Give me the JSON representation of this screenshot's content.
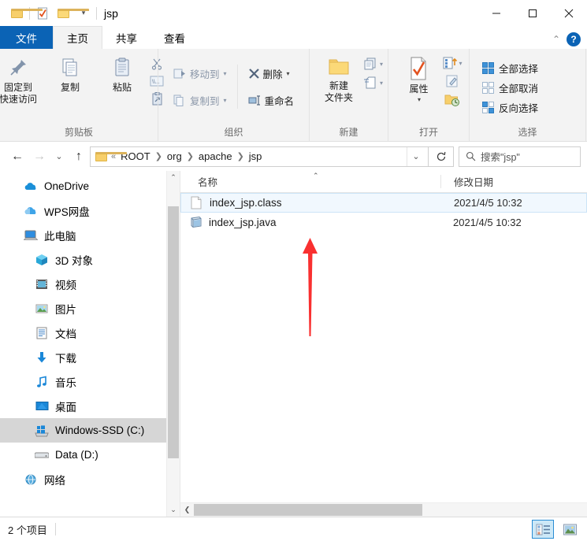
{
  "window": {
    "title": "jsp",
    "quick_access": [
      "folder-icon",
      "properties-icon",
      "new-folder-icon",
      "customize-dropdown"
    ],
    "controls": {
      "minimize": "—",
      "maximize": "☐",
      "close": "✕"
    }
  },
  "ribbon": {
    "tabs": [
      {
        "label": "文件",
        "kind": "file"
      },
      {
        "label": "主页",
        "kind": "active"
      },
      {
        "label": "共享",
        "kind": "normal"
      },
      {
        "label": "查看",
        "kind": "normal"
      }
    ],
    "collapse_icon": "chevron-up-icon",
    "help_label": "?",
    "groups": [
      {
        "name": "剪贴板",
        "big": [
          {
            "label1": "固定到",
            "label2": "快速访问",
            "icon": "pin-icon"
          },
          {
            "label1": "复制",
            "label2": "",
            "icon": "copy-icon"
          },
          {
            "label1": "粘贴",
            "label2": "",
            "icon": "paste-icon"
          }
        ],
        "small": [
          "剪切",
          "复制路径",
          "粘贴快捷方式"
        ]
      },
      {
        "name": "组织",
        "items": [
          {
            "label": "移动到",
            "icon": "move-to-icon",
            "caret": true,
            "enabled": false
          },
          {
            "label": "复制到",
            "icon": "copy-to-icon",
            "caret": true,
            "enabled": false
          },
          {
            "label": "删除",
            "icon": "delete-icon",
            "caret": true,
            "enabled": true
          },
          {
            "label": "重命名",
            "icon": "rename-icon",
            "caret": false,
            "enabled": true
          }
        ]
      },
      {
        "name": "新建",
        "big": [
          {
            "label1": "新建",
            "label2": "文件夹",
            "icon": "new-folder-icon"
          }
        ],
        "small": [
          "新建项目",
          "轻松访问"
        ]
      },
      {
        "name": "打开",
        "big": [
          {
            "label1": "属性",
            "label2": "",
            "icon": "properties-icon"
          }
        ],
        "small": [
          "打开方式",
          "编辑",
          "历史记录"
        ]
      },
      {
        "name": "选择",
        "items": [
          {
            "label": "全部选择",
            "icon": "select-all-icon"
          },
          {
            "label": "全部取消",
            "icon": "select-none-icon"
          },
          {
            "label": "反向选择",
            "icon": "invert-selection-icon"
          }
        ]
      }
    ]
  },
  "addressbar": {
    "back_icon": "arrow-left-icon",
    "forward_icon": "arrow-right-icon",
    "recent_icon": "chevron-down-icon",
    "up_icon": "arrow-up-icon",
    "folder_icon": "folder-icon",
    "overflow": "«",
    "crumbs": [
      "ROOT",
      "org",
      "apache",
      "jsp"
    ],
    "dropdown_icon": "chevron-down-icon",
    "refresh_icon": "refresh-icon",
    "search_icon": "search-icon",
    "search_placeholder": "搜索\"jsp\""
  },
  "sidebar": {
    "items": [
      {
        "label": "OneDrive",
        "icon": "onedrive-icon",
        "indent": false,
        "selected": false
      },
      {
        "label": "WPS网盘",
        "icon": "wps-cloud-icon",
        "indent": false,
        "selected": false
      },
      {
        "label": "此电脑",
        "icon": "this-pc-icon",
        "indent": false,
        "selected": false
      },
      {
        "label": "3D 对象",
        "icon": "3d-objects-icon",
        "indent": true,
        "selected": false
      },
      {
        "label": "视频",
        "icon": "videos-icon",
        "indent": true,
        "selected": false
      },
      {
        "label": "图片",
        "icon": "pictures-icon",
        "indent": true,
        "selected": false
      },
      {
        "label": "文档",
        "icon": "documents-icon",
        "indent": true,
        "selected": false
      },
      {
        "label": "下载",
        "icon": "downloads-icon",
        "indent": true,
        "selected": false
      },
      {
        "label": "音乐",
        "icon": "music-icon",
        "indent": true,
        "selected": false
      },
      {
        "label": "桌面",
        "icon": "desktop-icon",
        "indent": true,
        "selected": false
      },
      {
        "label": "Windows-SSD (C:)",
        "icon": "windows-drive-icon",
        "indent": true,
        "selected": true
      },
      {
        "label": "Data (D:)",
        "icon": "drive-icon",
        "indent": true,
        "selected": false
      },
      {
        "label": "网络",
        "icon": "network-icon",
        "indent": false,
        "selected": false
      }
    ],
    "scroll_up_icon": "chevron-up-icon",
    "scroll_down_icon": "chevron-down-icon"
  },
  "filelist": {
    "columns": [
      {
        "label": "名称",
        "sorted": "asc"
      },
      {
        "label": "修改日期",
        "sorted": ""
      }
    ],
    "rows": [
      {
        "name": "index_jsp.class",
        "date": "2021/4/5 10:32",
        "icon": "blank-file-icon",
        "selected": true
      },
      {
        "name": "index_jsp.java",
        "date": "2021/4/5 10:32",
        "icon": "java-file-icon",
        "selected": false
      }
    ],
    "hscroll_left_icon": "chevron-left-icon"
  },
  "statusbar": {
    "item_count": "2 个项目",
    "views": [
      {
        "name": "details-view",
        "icon": "details-view-icon",
        "active": true
      },
      {
        "name": "large-icons-view",
        "icon": "large-icons-view-icon",
        "active": false
      }
    ]
  },
  "annotation": {
    "type": "red-arrow",
    "color": "#f93030",
    "points_to": "index_jsp.java"
  }
}
